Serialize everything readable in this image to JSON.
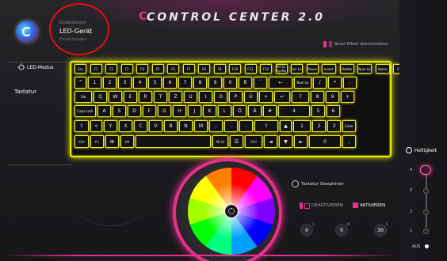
{
  "app": {
    "title": "CONTROL CENTER 2.0",
    "window_controls": {
      "minimize": "–",
      "close": "✕",
      "extra": "–"
    },
    "accent": "#e8308a",
    "keyboard_color": "#ecec00"
  },
  "breadcrumb": {
    "small": "Einstellungen",
    "main": "LED-Gerät",
    "sub": "Einstellungen"
  },
  "boost": {
    "label": "Boost Effekt überschreiben"
  },
  "sidebar": {
    "mode_label": "LED-Modus",
    "item": "Tastatur"
  },
  "keyboard": {
    "rows": [
      [
        "Esc",
        "F1",
        "F2",
        "F3",
        "F4",
        "F5",
        "F6",
        "F7",
        "F8",
        "F9",
        "F10",
        "F11",
        "F12",
        "Prt Sc SysRq",
        "Scr Lk",
        "Pause",
        "Insert",
        "Delete",
        "Num Lk",
        "Home",
        "End"
      ],
      [
        "^",
        "1",
        "2",
        "3",
        "4",
        "5",
        "6",
        "7",
        "8",
        "9",
        "0",
        "ß",
        "´",
        "←",
        "Num Lk",
        "/",
        "*",
        "-"
      ],
      [
        "Tab",
        "Q",
        "W",
        "E",
        "R",
        "T",
        "Z",
        "U",
        "I",
        "O",
        "P",
        "Ü",
        "+",
        "↵",
        "7",
        "8",
        "9",
        "+"
      ],
      [
        "Caps Lock",
        "A",
        "S",
        "D",
        "F",
        "G",
        "H",
        "J",
        "K",
        "L",
        "Ö",
        "Ä",
        "#",
        "4",
        "5",
        "6"
      ],
      [
        "⇧",
        "<",
        "Y",
        "X",
        "C",
        "V",
        "B",
        "N",
        "M",
        ",",
        ".",
        "-",
        "⇧",
        "▲",
        "1",
        "2",
        "3",
        "Enter"
      ],
      [
        "Ctrl",
        "Fn",
        "⊞",
        "Alt",
        "",
        "Alt Gr",
        "☰",
        "Ctrl",
        "◄",
        "▼",
        "►",
        "0",
        ","
      ]
    ]
  },
  "wheel_colors": [
    "#ff0000",
    "#ff00ff",
    "#8000ff",
    "#0000ff",
    "#00a0ff",
    "#00ff80",
    "#00ff00",
    "#a0ff00",
    "#ffff00",
    "#ff8000"
  ],
  "sleep": {
    "title": "Tastatur Sleeptimer",
    "deactivate": "DEAKTIVIEREN",
    "activate": "AKTIVIEREN",
    "hours": "0",
    "hours_unit": "H",
    "minutes": "0",
    "minutes_unit": "M",
    "seconds": "30",
    "seconds_unit": "S"
  },
  "brightness": {
    "title": "Helligkeit",
    "levels": [
      "4",
      "3",
      "2",
      "1"
    ],
    "off_label": "AUS",
    "current": 4
  }
}
